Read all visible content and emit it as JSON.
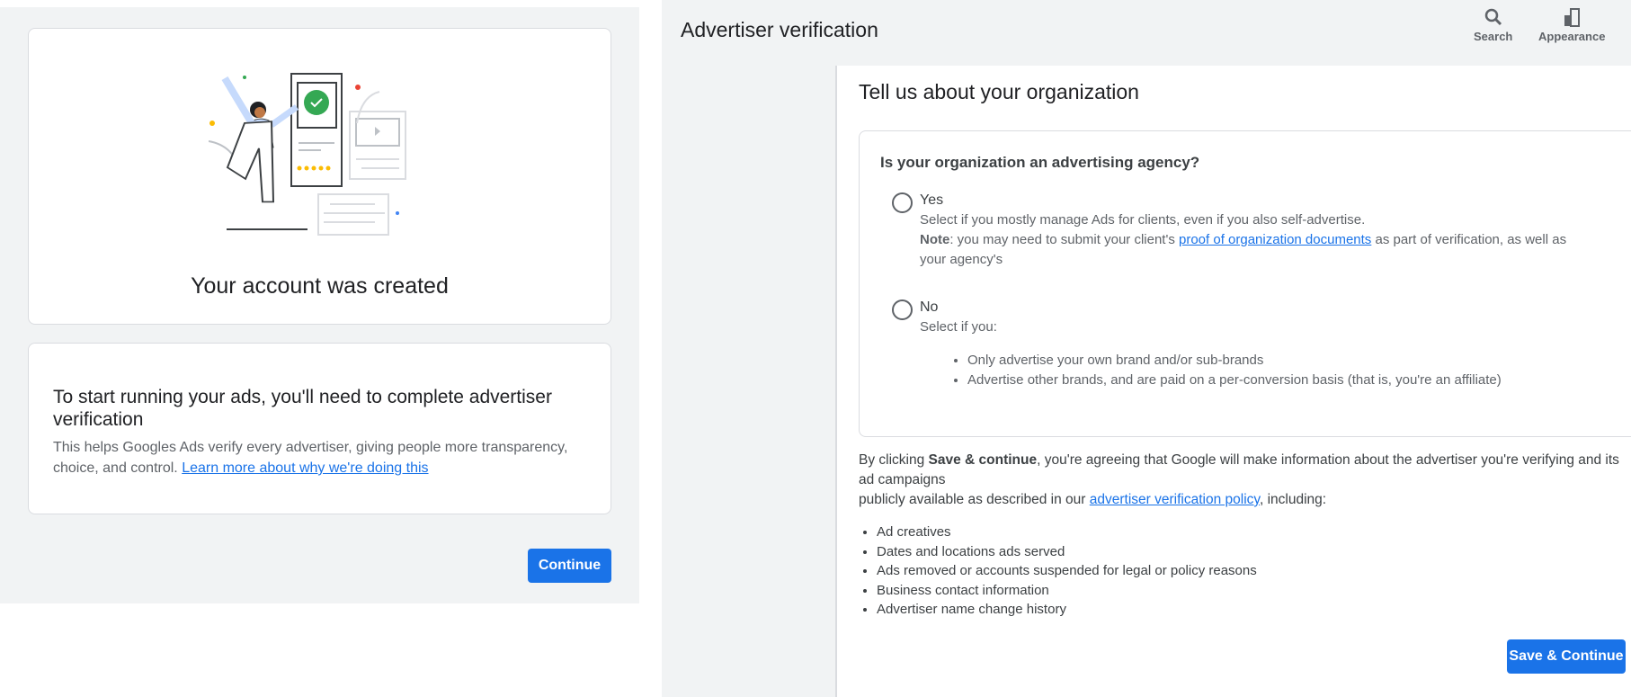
{
  "left_panel": {
    "created_title": "Your account was created",
    "heading": "To start running your ads, you'll need to complete advertiser verification",
    "body": "This helps Googles Ads verify every advertiser, giving people more transparency, choice, and control.",
    "learn_more_link": "Learn more about why we're doing this",
    "continue_label": "Continue"
  },
  "right_panel": {
    "header": {
      "title": "Advertiser verification",
      "tools": [
        {
          "label": "Search",
          "icon": "search-icon"
        },
        {
          "label": "Appearance",
          "icon": "appearance-icon"
        }
      ]
    },
    "section_title": "Tell us about your organization",
    "question": "Is your organization an advertising agency?",
    "options": [
      {
        "label": "Yes",
        "selected": false,
        "desc": "Select if you mostly manage Ads for clients, even if you also self-advertise.",
        "note_bold": "Note",
        "note_pre": ": you may need to submit your client's ",
        "note_link": "proof of organization documents",
        "note_post": " as part of verification, as well as your agency's"
      },
      {
        "label": "No",
        "selected": false,
        "desc": "Select if you:",
        "bullets": [
          "Only advertise your own brand and/or sub-brands",
          "Advertise other brands, and are paid on a per-conversion basis (that is, you're an affiliate)"
        ]
      }
    ],
    "consent": {
      "pre": "By clicking ",
      "bold": "Save & continue",
      "mid": ", you're agreeing that Google will make information about the advertiser you're verifying and its ad campaigns",
      "line2_pre": "publicly available as described in our ",
      "link": "advertiser verification policy",
      "line2_post": ", including:",
      "items": [
        "Ad creatives",
        "Dates and locations ads served",
        "Ads removed or accounts suspended for legal or policy reasons",
        "Business contact information",
        "Advertiser name change history"
      ]
    },
    "save_label": "Save & Continue"
  },
  "colors": {
    "primary": "#1a73e8",
    "background": "#f1f3f4",
    "success": "#34a853"
  }
}
